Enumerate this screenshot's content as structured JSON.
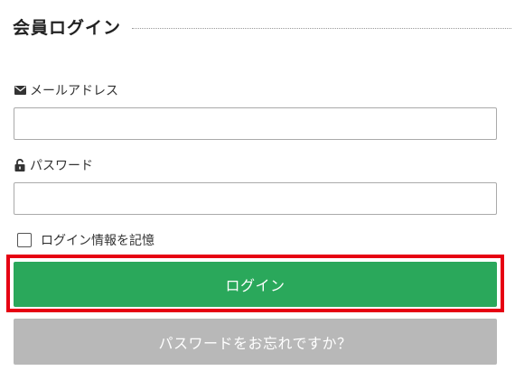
{
  "title": "会員ログイン",
  "email": {
    "label": "メールアドレス",
    "icon": "envelope-icon",
    "value": ""
  },
  "password": {
    "label": "パスワード",
    "icon": "unlock-icon",
    "value": ""
  },
  "remember": {
    "label": "ログイン情報を記憶",
    "checked": false
  },
  "buttons": {
    "login": "ログイン",
    "forgot": "パスワードをお忘れですか？"
  },
  "colors": {
    "login_button": "#2aa85b",
    "forgot_button": "#b8b8b8",
    "highlight_border": "#e60012"
  }
}
